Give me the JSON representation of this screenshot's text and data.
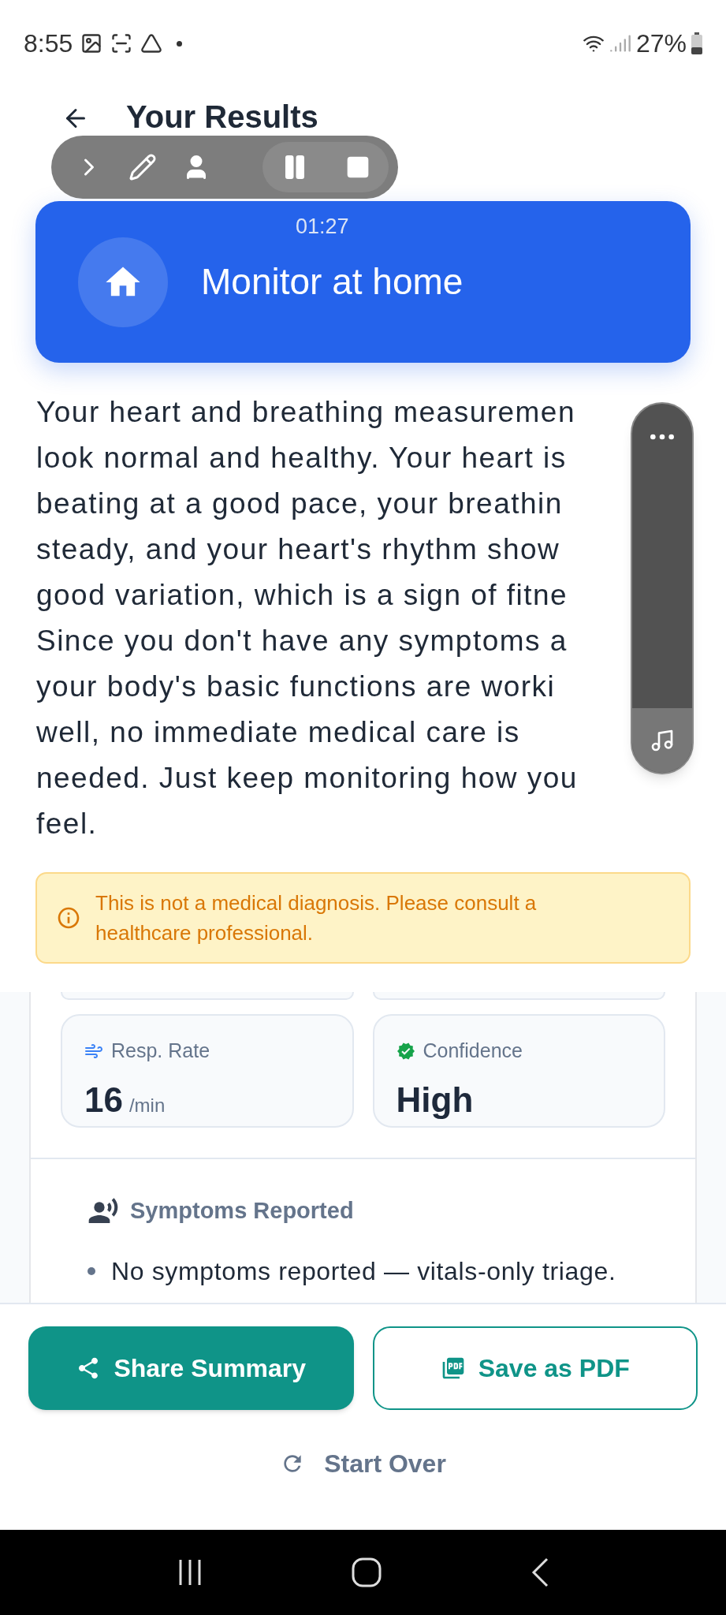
{
  "status_bar": {
    "time": "8:55",
    "battery": "27%"
  },
  "header": {
    "title": "Your Results"
  },
  "recorder": {
    "timer": "01:27"
  },
  "triage": {
    "title": "Monitor at home"
  },
  "summary_lines": [
    "Your heart and breathing measuremen",
    "look normal and healthy. Your heart is",
    "beating at a good pace, your breathin",
    "steady, and your heart's rhythm show",
    "good variation, which is a sign of fitne",
    "Since you don't have any symptoms a",
    "your body's basic functions are worki",
    "well, no immediate medical care is",
    "needed. Just keep monitoring how you",
    "feel."
  ],
  "disclaimer": "This is not a medical diagnosis. Please consult a healthcare professional.",
  "metrics": [
    {
      "kind": "wind",
      "label": "Resp. Rate",
      "value": "16",
      "unit": "/min"
    },
    {
      "kind": "verified",
      "label": "Confidence",
      "value": "High"
    }
  ],
  "symptoms": {
    "title": "Symptoms Reported",
    "items": [
      "No symptoms reported — vitals-only triage."
    ]
  },
  "actions": [
    {
      "kind": "primary",
      "label": "Share Summary"
    },
    {
      "kind": "outline",
      "label": "Save as PDF"
    }
  ],
  "start_over": "Start Over"
}
